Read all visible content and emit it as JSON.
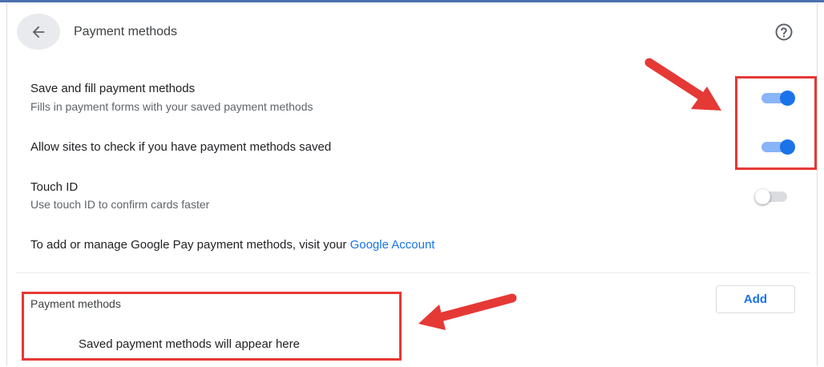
{
  "header": {
    "title": "Payment methods",
    "back_icon": "arrow-left-icon",
    "help_icon": "help-circle-icon"
  },
  "settings": [
    {
      "title": "Save and fill payment methods",
      "subtitle": "Fills in payment forms with your saved payment methods",
      "enabled": true
    },
    {
      "title": "Allow sites to check if you have payment methods saved",
      "subtitle": "",
      "enabled": true
    },
    {
      "title": "Touch ID",
      "subtitle": "Use touch ID to confirm cards faster",
      "enabled": false
    }
  ],
  "google_pay": {
    "text": "To add or manage Google Pay payment methods, visit your ",
    "link": "Google Account"
  },
  "payment_methods": {
    "heading": "Payment methods",
    "add_label": "Add",
    "empty_message": "Saved payment methods will appear here"
  },
  "colors": {
    "accent": "#1a73e8",
    "annotation": "#e53935",
    "toggle_track_on": "#8ab4f8"
  }
}
